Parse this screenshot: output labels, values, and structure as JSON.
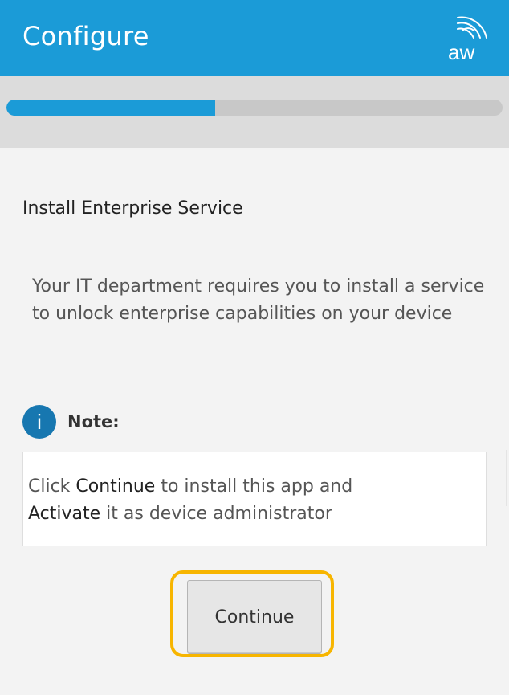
{
  "header": {
    "title": "Configure",
    "logo_text": "aw",
    "background_color": "#1b9bd7"
  },
  "progress": {
    "fraction": 0.42,
    "fill_color": "#1b9bd7"
  },
  "main": {
    "section_title": "Install Enterprise Service",
    "description": "Your IT department requires you to install a service to unlock enterprise capabilities on your device",
    "note": {
      "icon": "info-icon",
      "icon_glyph": "i",
      "label": "Note:",
      "text_part1": "Click ",
      "text_bold1": "Continue",
      "text_part2": " to install this app and ",
      "text_bold2": "Activate",
      "text_part3": " it as device administrator"
    },
    "continue_label": "Continue",
    "highlight_color": "#f7b500"
  }
}
